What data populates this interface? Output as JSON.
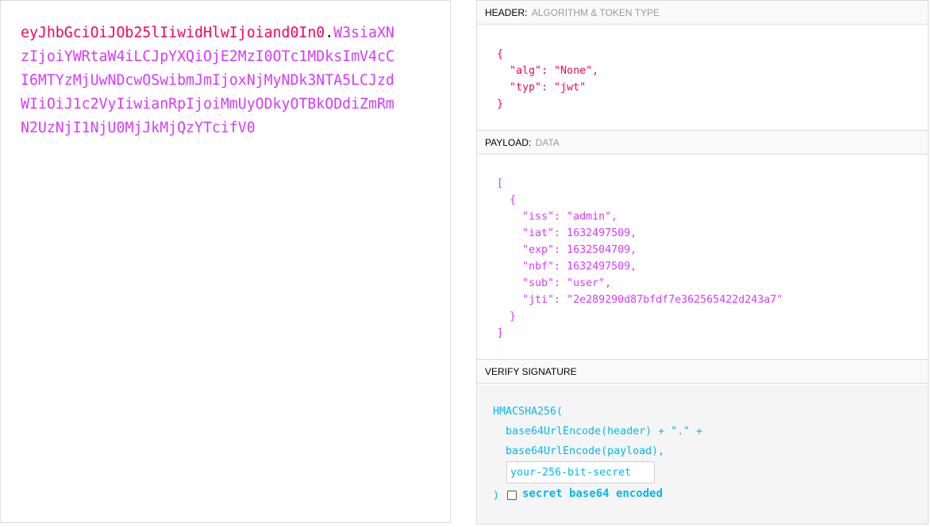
{
  "encoded": {
    "header_part": "eyJhbGciOiJOb25lIiwidHlwIjoiand0In0",
    "dot": ".",
    "payload_part": "W3siaXNzIjoiYWRtaW4iLCJpYXQiOjE2MzI0OTc1MDksImV4cCI6MTYzMjUwNDcwOSwibmJmIjoxNjMyNDk3NTA5LCJzdWIiOiJ1c2VyIiwianRpIjoiMmUyODkyOTBkODdiZmRmN2UzNjI1NjU0MjJkMjQzYTcifV0"
  },
  "decoded": {
    "header": {
      "title": "HEADER:",
      "subtitle": "ALGORITHM & TOKEN TYPE",
      "json": "{\n  \"alg\": \"None\",\n  \"typ\": \"jwt\"\n}"
    },
    "payload": {
      "title": "PAYLOAD:",
      "subtitle": "DATA",
      "json": "[\n  {\n    \"iss\": \"admin\",\n    \"iat\": 1632497509,\n    \"exp\": 1632504709,\n    \"nbf\": 1632497509,\n    \"sub\": \"user\",\n    \"jti\": \"2e289290d87bfdf7e362565422d243a7\"\n  }\n]"
    },
    "verify": {
      "title": "VERIFY SIGNATURE",
      "line1": "HMACSHA256(",
      "line2": "  base64UrlEncode(header) + \".\" +",
      "line3": "  base64UrlEncode(payload),",
      "secret_placeholder": "your-256-bit-secret",
      "close_paren": ")",
      "checkbox_label": "secret base64 encoded",
      "checkbox_checked": false
    }
  },
  "colors": {
    "header": "#fb015b",
    "payload": "#d63aff",
    "signature": "#00b9f1"
  }
}
